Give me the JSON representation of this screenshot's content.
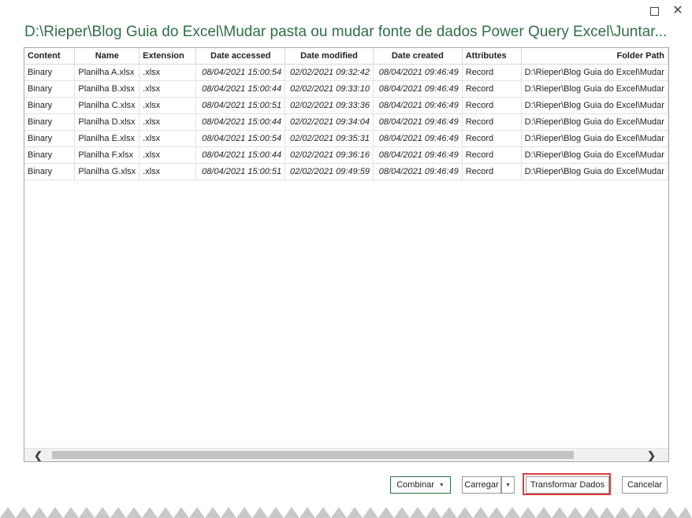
{
  "dialog": {
    "title": "D:\\Rieper\\Blog Guia do Excel\\Mudar pasta ou mudar fonte de dados Power Query Excel\\Juntar...",
    "window_controls": {
      "maximize_icon": "maximize-icon",
      "close_icon": "close-icon"
    }
  },
  "table": {
    "columns": [
      "Content",
      "Name",
      "Extension",
      "Date accessed",
      "Date modified",
      "Date created",
      "Attributes",
      "Folder Path"
    ],
    "rows": [
      [
        "Binary",
        "Planilha A.xlsx",
        ".xlsx",
        "08/04/2021 15:00:54",
        "02/02/2021 09:32:42",
        "08/04/2021 09:46:49",
        "Record",
        "D:\\Rieper\\Blog Guia do Excel\\Mudar"
      ],
      [
        "Binary",
        "Planilha B.xlsx",
        ".xlsx",
        "08/04/2021 15:00:44",
        "02/02/2021 09:33:10",
        "08/04/2021 09:46:49",
        "Record",
        "D:\\Rieper\\Blog Guia do Excel\\Mudar"
      ],
      [
        "Binary",
        "Planilha C.xlsx",
        ".xlsx",
        "08/04/2021 15:00:51",
        "02/02/2021 09:33:36",
        "08/04/2021 09:46:49",
        "Record",
        "D:\\Rieper\\Blog Guia do Excel\\Mudar"
      ],
      [
        "Binary",
        "Planilha D.xlsx",
        ".xlsx",
        "08/04/2021 15:00:44",
        "02/02/2021 09:34:04",
        "08/04/2021 09:46:49",
        "Record",
        "D:\\Rieper\\Blog Guia do Excel\\Mudar"
      ],
      [
        "Binary",
        "Planilha E.xlsx",
        ".xlsx",
        "08/04/2021 15:00:54",
        "02/02/2021 09:35:31",
        "08/04/2021 09:46:49",
        "Record",
        "D:\\Rieper\\Blog Guia do Excel\\Mudar"
      ],
      [
        "Binary",
        "Planilha F.xlsx",
        ".xlsx",
        "08/04/2021 15:00:44",
        "02/02/2021 09:36:16",
        "08/04/2021 09:46:49",
        "Record",
        "D:\\Rieper\\Blog Guia do Excel\\Mudar"
      ],
      [
        "Binary",
        "Planilha G.xlsx",
        ".xlsx",
        "08/04/2021 15:00:51",
        "02/02/2021 09:49:59",
        "08/04/2021 09:46:49",
        "Record",
        "D:\\Rieper\\Blog Guia do Excel\\Mudar"
      ]
    ]
  },
  "scrollbar": {
    "left_icon": "chevron-left-icon",
    "right_icon": "chevron-right-icon"
  },
  "buttons": {
    "combinar": "Combinar",
    "carregar": "Carregar",
    "transformar": "Transformar Dados",
    "cancelar": "Cancelar"
  },
  "colors": {
    "title": "#2f6f47",
    "highlight": "#e03c3c"
  }
}
